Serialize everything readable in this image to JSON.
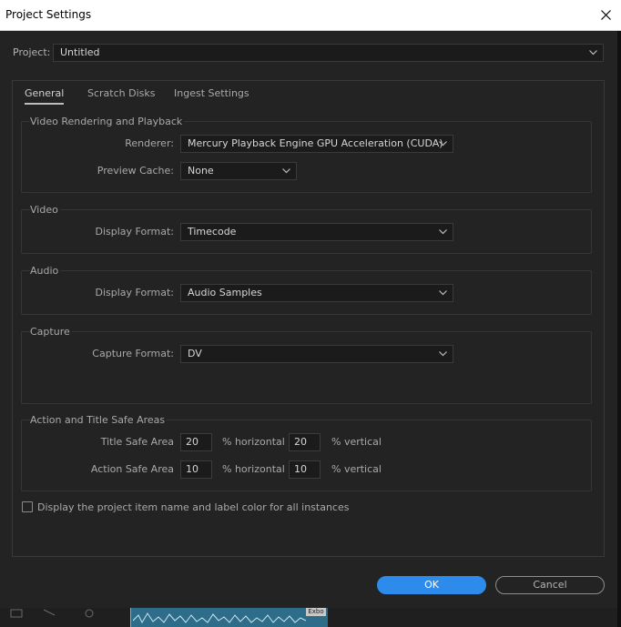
{
  "window": {
    "title": "Project Settings",
    "close_icon": "close-icon"
  },
  "project": {
    "label": "Project:",
    "value": "Untitled"
  },
  "tabs": [
    {
      "label": "General",
      "active": true
    },
    {
      "label": "Scratch Disks",
      "active": false
    },
    {
      "label": "Ingest Settings",
      "active": false
    }
  ],
  "video_rendering": {
    "title": "Video Rendering and Playback",
    "renderer_label": "Renderer:",
    "renderer_value": "Mercury Playback Engine GPU Acceleration (CUDA)",
    "preview_cache_label": "Preview Cache:",
    "preview_cache_value": "None"
  },
  "video": {
    "title": "Video",
    "display_format_label": "Display Format:",
    "display_format_value": "Timecode"
  },
  "audio": {
    "title": "Audio",
    "display_format_label": "Display Format:",
    "display_format_value": "Audio Samples"
  },
  "capture": {
    "title": "Capture",
    "capture_format_label": "Capture Format:",
    "capture_format_value": "DV"
  },
  "safe_areas": {
    "title": "Action and Title Safe Areas",
    "title_safe_label": "Title Safe Area",
    "title_safe_horizontal": "20",
    "title_safe_vertical": "20",
    "action_safe_label": "Action Safe Area",
    "action_safe_horizontal": "10",
    "action_safe_vertical": "10",
    "horizontal_unit": "% horizontal",
    "vertical_unit": "% vertical"
  },
  "display_label_color": {
    "label": "Display the project item name and label color for all instances",
    "checked": false
  },
  "buttons": {
    "ok": "OK",
    "cancel": "Cancel"
  },
  "background": {
    "clip_tag": "Exbo"
  },
  "colors": {
    "accent": "#2d8ceb",
    "dialog_bg": "#232323",
    "field_bg": "#1b1b1b"
  }
}
